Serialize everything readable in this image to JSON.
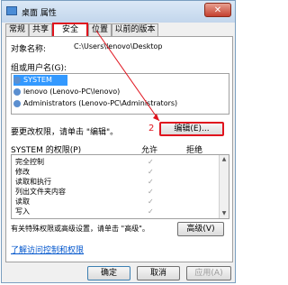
{
  "window": {
    "title": "桌面 属性",
    "close_label": "✕"
  },
  "tabs": [
    {
      "label": "常规"
    },
    {
      "label": "共享"
    },
    {
      "label": "安全"
    },
    {
      "label": "位置"
    },
    {
      "label": "以前的版本"
    }
  ],
  "object_name": {
    "label": "对象名称:",
    "value": "C:\\Users\\lenovo\\Desktop"
  },
  "group_label": "组或用户名(G):",
  "users": [
    {
      "name": "SYSTEM"
    },
    {
      "name": "lenovo (Lenovo-PC\\lenovo)"
    },
    {
      "name": "Administrators (Lenovo-PC\\Administrators)"
    }
  ],
  "edit_prompt": "要更改权限，请单击 \"编辑\"。",
  "edit_button": "编辑(E)...",
  "annotation_number": "2",
  "permissions": {
    "header_label": "SYSTEM 的权限(P)",
    "allow_label": "允许",
    "deny_label": "拒绝",
    "items": [
      {
        "label": "完全控制"
      },
      {
        "label": "修改"
      },
      {
        "label": "读取和执行"
      },
      {
        "label": "列出文件夹内容"
      },
      {
        "label": "读取"
      },
      {
        "label": "写入"
      }
    ]
  },
  "special_prompt": "有关特殊权限或高级设置，请单击 \"高级\"。",
  "advanced_button": "高级(V)",
  "learn_link": "了解访问控制和权限",
  "buttons": {
    "ok": "确定",
    "cancel": "取消",
    "apply": "应用(A)"
  },
  "colors": {
    "annotation_red": "#e0141e",
    "link_blue": "#0055cc"
  }
}
